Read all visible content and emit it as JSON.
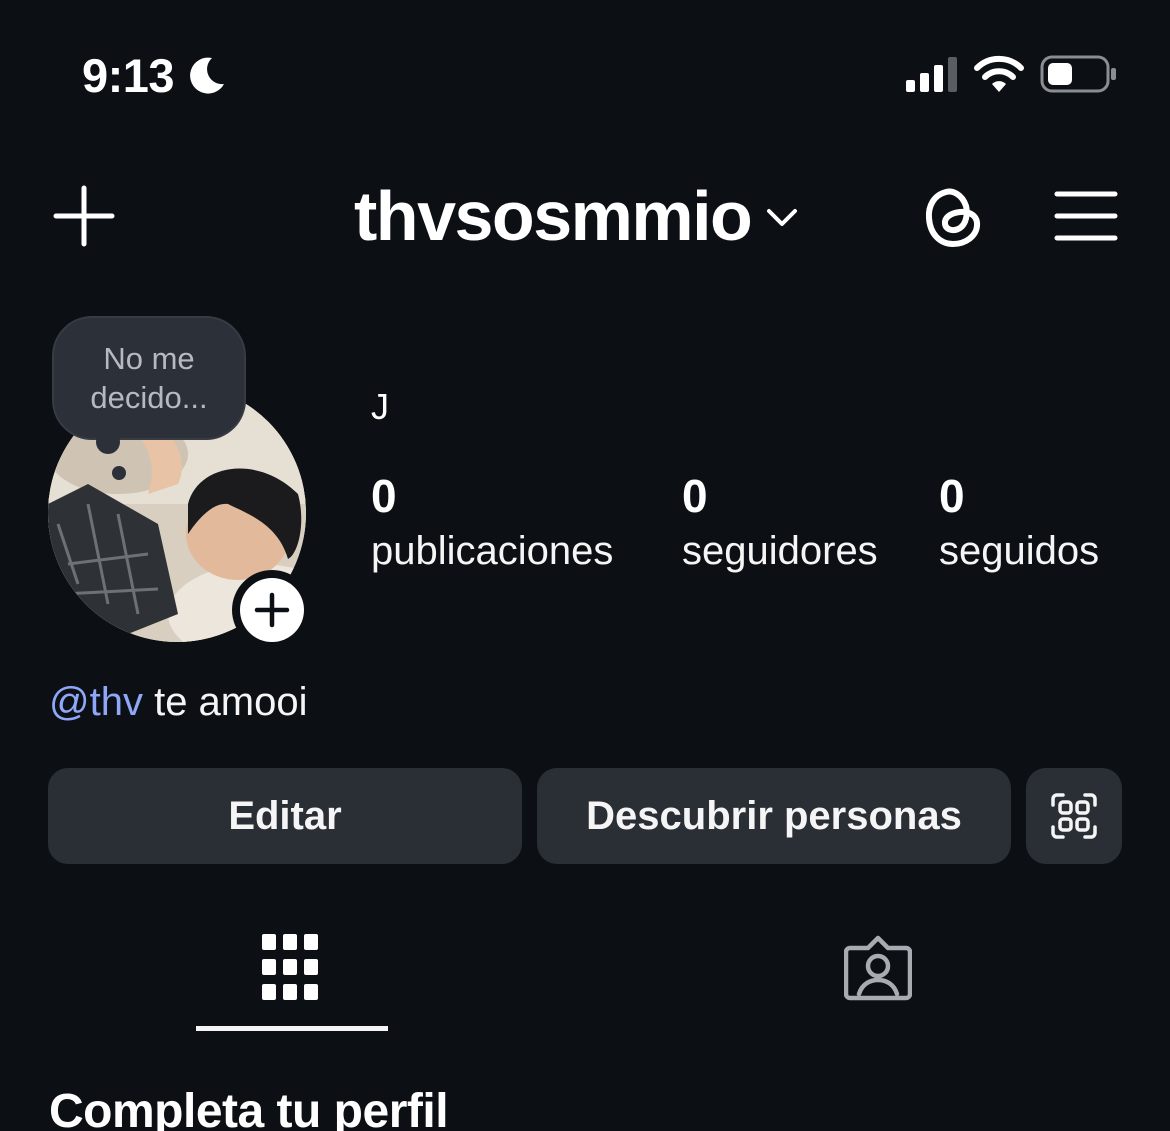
{
  "status_bar": {
    "time": "9:13",
    "icons": [
      "moon-icon",
      "signal-icon",
      "wifi-icon",
      "battery-icon"
    ],
    "battery_level": 0.3
  },
  "header": {
    "username": "thvsosmmio",
    "icons": [
      "plus-icon",
      "chevron-down-icon",
      "threads-icon",
      "menu-icon"
    ]
  },
  "profile": {
    "note": "No me decido...",
    "display_name": "J",
    "stats": [
      {
        "value": "0",
        "label": "publicaciones"
      },
      {
        "value": "0",
        "label": "seguidores"
      },
      {
        "value": "0",
        "label": "seguidos"
      }
    ],
    "bio_mention": "@thv",
    "bio_text": " te amooi"
  },
  "actions": {
    "edit_label": "Editar",
    "discover_label": "Descubrir personas",
    "qr_icon": "qr-code-icon"
  },
  "tabs": {
    "grid_icon": "grid-icon",
    "tagged_icon": "tagged-icon",
    "active": "grid"
  },
  "sections": {
    "complete_profile_title": "Completa tu perfil"
  },
  "colors": {
    "background": "#0c1014",
    "button": "#2a2e35",
    "mention": "#8ea7f7",
    "note_bubble": "#2c3038"
  }
}
